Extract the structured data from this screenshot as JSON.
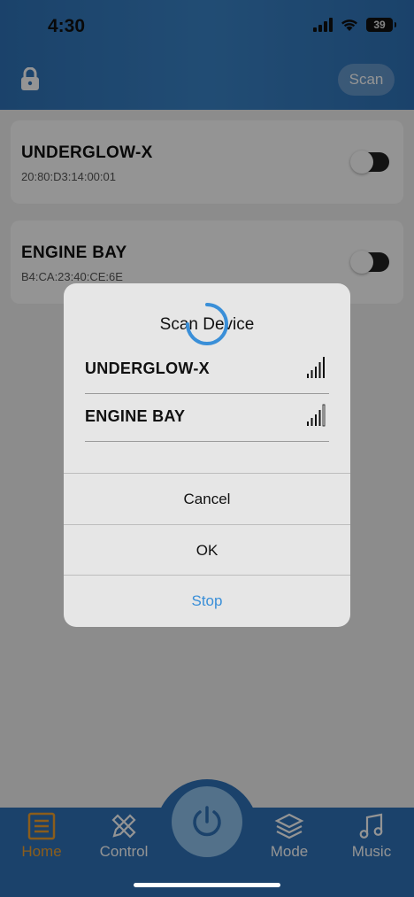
{
  "status_bar": {
    "time": "4:30",
    "battery": "39"
  },
  "header": {
    "scan_label": "Scan"
  },
  "devices": [
    {
      "name": "UNDERGLOW-X",
      "mac": "20:80:D3:14:00:01",
      "enabled": false
    },
    {
      "name": "ENGINE BAY",
      "mac": "B4:CA:23:40:CE:6E",
      "enabled": false
    }
  ],
  "dialog": {
    "title": "Scan Device",
    "results": [
      {
        "name": "UNDERGLOW-X",
        "signal_bars": 4
      },
      {
        "name": "ENGINE BAY",
        "signal_bars": 4
      }
    ],
    "cancel_label": "Cancel",
    "ok_label": "OK",
    "stop_label": "Stop"
  },
  "nav": {
    "home": "Home",
    "control": "Control",
    "mode": "Mode",
    "music": "Music"
  },
  "colors": {
    "primary": "#2f73b8",
    "active_nav": "#f0a030",
    "stop": "#3a8fd8",
    "power": "#8fc3ee"
  },
  "icons": [
    "lock-icon",
    "power-icon",
    "home-list-icon",
    "pencil-ruler-icon",
    "layers-icon",
    "music-note-icon",
    "signal-icon",
    "spinner-icon"
  ]
}
